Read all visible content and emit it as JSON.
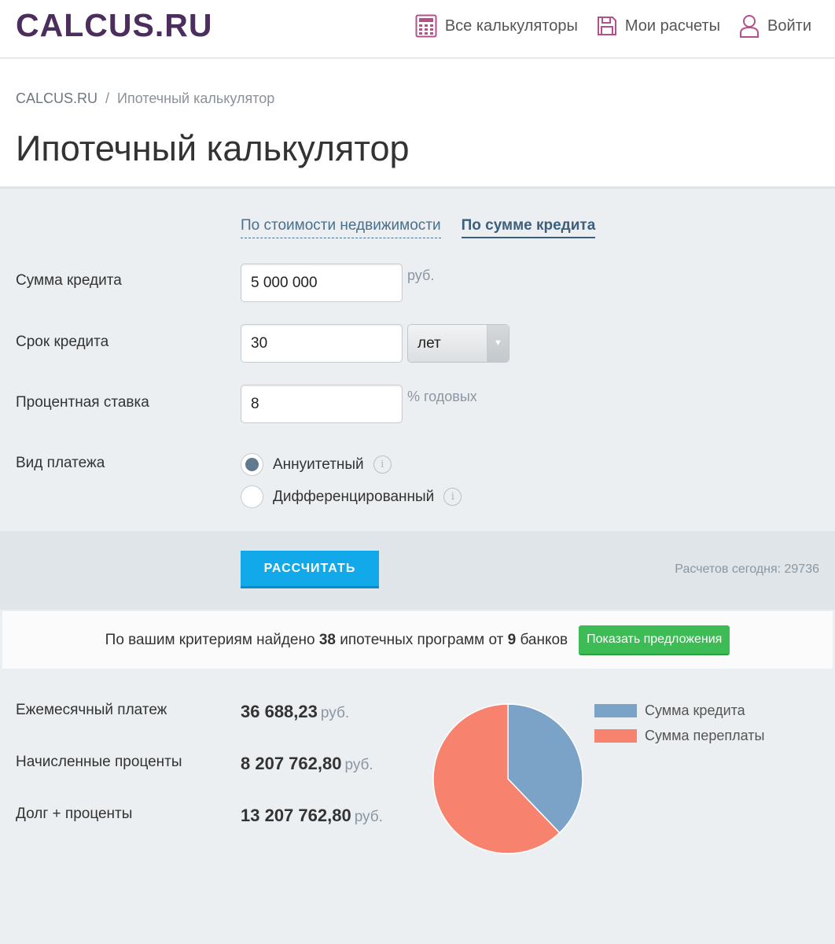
{
  "header": {
    "logo": "CALCUS.RU",
    "nav": [
      {
        "label": "Все калькуляторы",
        "icon": "calculator-icon"
      },
      {
        "label": "Мои расчеты",
        "icon": "save-icon"
      },
      {
        "label": "Войти",
        "icon": "user-icon"
      }
    ]
  },
  "breadcrumb": {
    "home": "CALCUS.RU",
    "separator": "/",
    "current": "Ипотечный калькулятор"
  },
  "page_title": "Ипотечный калькулятор",
  "tabs": [
    {
      "label": "По стоимости недвижимости",
      "active": false
    },
    {
      "label": "По сумме кредита",
      "active": true
    }
  ],
  "form": {
    "amount": {
      "label": "Сумма кредита",
      "value": "5 000 000",
      "unit": "руб."
    },
    "term": {
      "label": "Срок кредита",
      "value": "30",
      "period": "лет"
    },
    "rate": {
      "label": "Процентная ставка",
      "value": "8",
      "unit": "% годовых"
    },
    "payment_type": {
      "label": "Вид платежа",
      "options": [
        {
          "label": "Аннуитетный",
          "checked": true
        },
        {
          "label": "Дифференцированный",
          "checked": false
        }
      ]
    }
  },
  "calc": {
    "button": "РАССЧИТАТЬ",
    "counter": "Расчетов сегодня: 29736"
  },
  "offers": {
    "text_before": "По вашим критериям найдено",
    "programs": "38",
    "text_middle": "ипотечных программ от",
    "banks": "9",
    "text_after": "банков",
    "button": "Показать предложения"
  },
  "results": [
    {
      "label": "Ежемесячный платеж",
      "value": "36 688,23",
      "unit": "руб."
    },
    {
      "label": "Начисленные проценты",
      "value": "8 207 762,80",
      "unit": "руб."
    },
    {
      "label": "Долг + проценты",
      "value": "13 207 762,80",
      "unit": "руб."
    }
  ],
  "chart_data": {
    "type": "pie",
    "categories": [
      "Сумма кредита",
      "Сумма переплаты"
    ],
    "values": [
      5000000,
      8207762.8
    ],
    "colors": [
      "#7aa3c7",
      "#f7836f"
    ],
    "legend": "top-right"
  },
  "colors": {
    "logo": "#4b2d5e",
    "accent": "#11a9ea",
    "offer_button": "#3dbb55",
    "nav_icon": "#b5508a"
  }
}
